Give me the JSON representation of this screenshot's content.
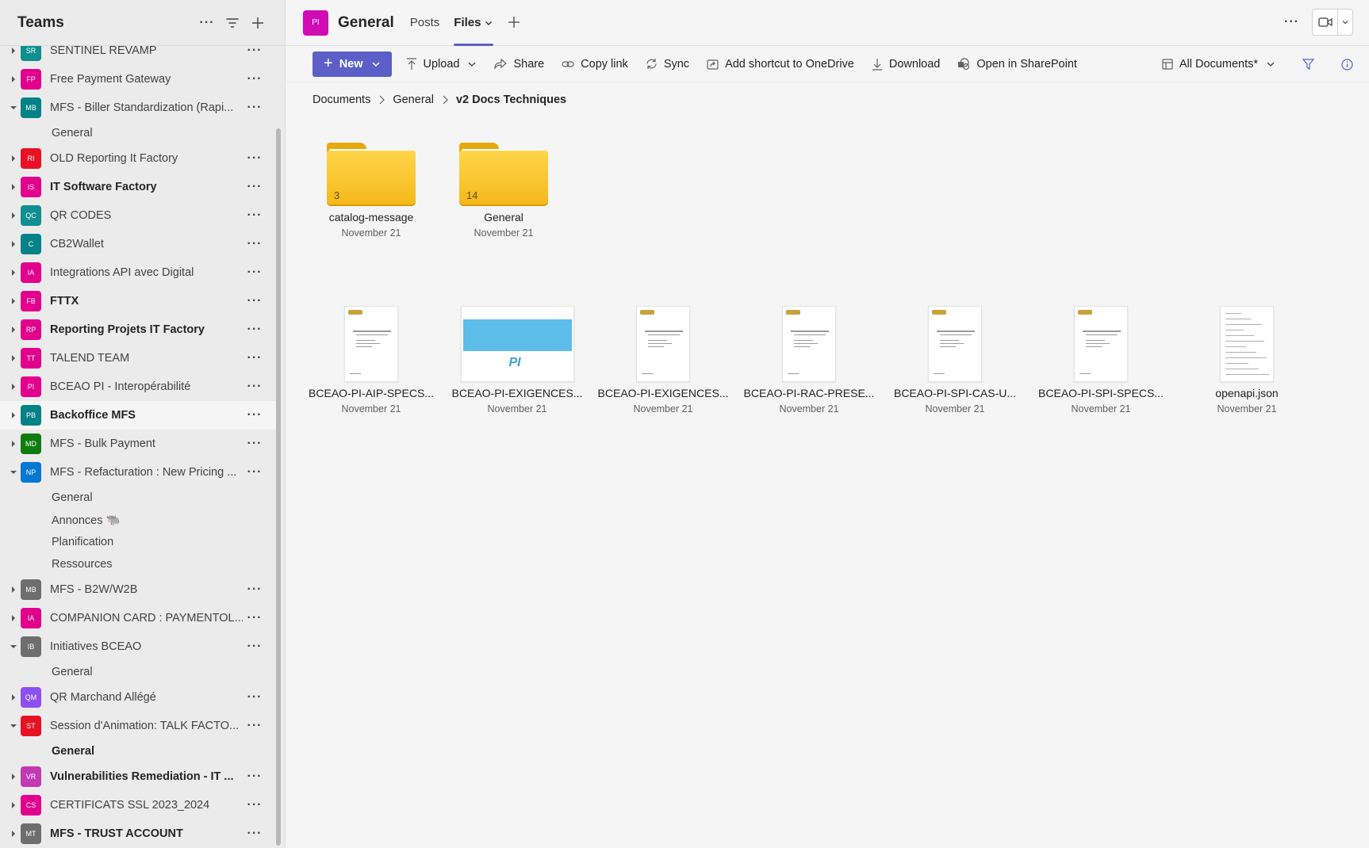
{
  "sidebar": {
    "title": "Teams",
    "teams": [
      {
        "initials": "SR",
        "color": "#0f8f8f",
        "name": "SENTINEL REVAMP",
        "bold": false,
        "expanded": false
      },
      {
        "initials": "FP",
        "color": "#e3008c",
        "name": "Free Payment Gateway",
        "bold": false,
        "expanded": false
      },
      {
        "initials": "MB",
        "color": "#038387",
        "name": "MFS - Biller Standardization (Rapi...",
        "bold": false,
        "expanded": true,
        "channels": [
          {
            "name": "General",
            "bold": false
          }
        ]
      },
      {
        "initials": "RI",
        "color": "#e81123",
        "name": "OLD Reporting It Factory",
        "bold": false,
        "expanded": false
      },
      {
        "initials": "IS",
        "color": "#e3008c",
        "name": "IT Software Factory",
        "bold": true,
        "expanded": false
      },
      {
        "initials": "QC",
        "color": "#0f8f8f",
        "name": "QR CODES",
        "bold": false,
        "expanded": false
      },
      {
        "initials": "C",
        "color": "#038387",
        "name": "CB2Wallet",
        "bold": false,
        "expanded": false
      },
      {
        "initials": "IA",
        "color": "#e3008c",
        "name": "Integrations API avec Digital",
        "bold": false,
        "expanded": false
      },
      {
        "initials": "FB",
        "color": "#e3008c",
        "name": "FTTX",
        "bold": true,
        "expanded": false
      },
      {
        "initials": "RP",
        "color": "#e3008c",
        "name": "Reporting Projets IT Factory",
        "bold": true,
        "expanded": false
      },
      {
        "initials": "TT",
        "color": "#e3008c",
        "name": "TALEND TEAM",
        "bold": false,
        "expanded": false
      },
      {
        "initials": "PI",
        "color": "#e3008c",
        "name": "BCEAO PI - Interopérabilité",
        "bold": false,
        "expanded": false
      },
      {
        "initials": "PB",
        "color": "#038387",
        "name": "Backoffice MFS",
        "bold": true,
        "expanded": false,
        "selected": true
      },
      {
        "initials": "MD",
        "color": "#107c10",
        "name": "MFS - Bulk Payment",
        "bold": false,
        "expanded": false
      },
      {
        "initials": "NP",
        "color": "#0078d4",
        "name": "MFS - Refacturation : New Pricing ...",
        "bold": false,
        "expanded": true,
        "channels": [
          {
            "name": "General",
            "bold": false
          },
          {
            "name": "Annonces 🐃",
            "bold": false
          },
          {
            "name": "Planification",
            "bold": false
          },
          {
            "name": "Ressources",
            "bold": false
          }
        ]
      },
      {
        "initials": "MB",
        "color": "#6e6e6e",
        "name": "MFS - B2W/W2B",
        "bold": false,
        "expanded": false
      },
      {
        "initials": "IA",
        "color": "#e3008c",
        "name": "COMPANION CARD : PAYMENTOL...",
        "bold": false,
        "expanded": false
      },
      {
        "initials": "IB",
        "color": "#6e6e6e",
        "name": "Initiatives BCEAO",
        "bold": false,
        "expanded": true,
        "channels": [
          {
            "name": "General",
            "bold": false
          }
        ]
      },
      {
        "initials": "QM",
        "color": "#8e4ff0",
        "name": "QR Marchand Allégé",
        "bold": false,
        "expanded": false
      },
      {
        "initials": "ST",
        "color": "#e81123",
        "name": "Session d'Animation: TALK FACTO...",
        "bold": false,
        "expanded": true,
        "channels": [
          {
            "name": "General",
            "bold": true
          }
        ]
      },
      {
        "initials": "VR",
        "color": "#c239b3",
        "name": "Vulnerabilities Remediation - IT ...",
        "bold": true,
        "expanded": false
      },
      {
        "initials": "CS",
        "color": "#e3008c",
        "name": "CERTIFICATS SSL 2023_2024",
        "bold": false,
        "expanded": false
      },
      {
        "initials": "MT",
        "color": "#6e6e6e",
        "name": "MFS - TRUST ACCOUNT",
        "bold": true,
        "expanded": false
      }
    ]
  },
  "channel": {
    "initials": "PI",
    "title": "General",
    "tabs": [
      "Posts",
      "Files"
    ]
  },
  "commands": {
    "new": "New",
    "upload": "Upload",
    "share": "Share",
    "copy_link": "Copy link",
    "sync": "Sync",
    "shortcut": "Add shortcut to OneDrive",
    "download": "Download",
    "sharepoint": "Open in SharePoint",
    "view": "All Documents*"
  },
  "breadcrumb": [
    "Documents",
    "General",
    "v2 Docs Techniques"
  ],
  "folders": [
    {
      "name": "catalog-message",
      "count": "3",
      "date": "November 21"
    },
    {
      "name": "General",
      "count": "14",
      "date": "November 21"
    }
  ],
  "files": [
    {
      "name": "BCEAO-PI-AIP-SPECS...",
      "date": "November 21",
      "kind": "doc"
    },
    {
      "name": "BCEAO-PI-EXIGENCES...",
      "date": "November 21",
      "kind": "wide"
    },
    {
      "name": "BCEAO-PI-EXIGENCES...",
      "date": "November 21",
      "kind": "doc"
    },
    {
      "name": "BCEAO-PI-RAC-PRESE...",
      "date": "November 21",
      "kind": "doc"
    },
    {
      "name": "BCEAO-PI-SPI-CAS-U...",
      "date": "November 21",
      "kind": "doc"
    },
    {
      "name": "BCEAO-PI-SPI-SPECS...",
      "date": "November 21",
      "kind": "doc"
    },
    {
      "name": "openapi.json",
      "date": "November 21",
      "kind": "text"
    }
  ],
  "colors": {
    "accent": "#5b5fc7",
    "folder": "#f5b91b"
  }
}
